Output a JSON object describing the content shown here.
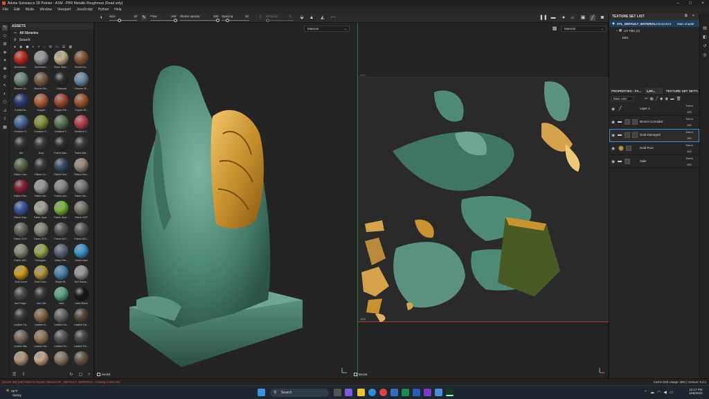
{
  "window": {
    "title": "Adobe Substance 3D Painter - ASM - PBR Metallic Roughness (Read only)"
  },
  "menu": [
    "File",
    "Edit",
    "Mode",
    "Window",
    "Viewport",
    "JavaScript",
    "Python",
    "Help"
  ],
  "toolbar": {
    "size_label": "Size",
    "size_value": "10",
    "flow_label": "Flow",
    "flow_value": "100",
    "stroke_opacity_label": "Stroke opacity",
    "stroke_opacity_value": "100",
    "spacing_label": "Spacing",
    "spacing_value": "20",
    "distance_label": "Distance",
    "distance_value": "0"
  },
  "assets": {
    "title": "ASSETS",
    "library": "All libraries",
    "search_placeholder": "Search",
    "materials": [
      {
        "name": "Aluminium...",
        "color": "#c52a1f"
      },
      {
        "name": "Aluminium...",
        "color": "#9a9a9a"
      },
      {
        "name": "Bone Style...",
        "color": "#c9b28a"
      },
      {
        "name": "Bronze Ar...",
        "color": "#8a5a35"
      },
      {
        "name": "Bronze Co...",
        "color": "#6f8c7a"
      },
      {
        "name": "Bronze Da...",
        "color": "#7a6048"
      },
      {
        "name": "Charcoal",
        "color": "#2d2d2d"
      },
      {
        "name": "Chrome Bl...",
        "color": "#6c8ea8"
      },
      {
        "name": "Cobalt Da...",
        "color": "#2a3e7a"
      },
      {
        "name": "Copper",
        "color": "#b5643a"
      },
      {
        "name": "Copper Re...",
        "color": "#a84a3a"
      },
      {
        "name": "Copper W...",
        "color": "#a85a30"
      },
      {
        "name": "Creature S...",
        "color": "#4a6a9a"
      },
      {
        "name": "Creature S...",
        "color": "#8a9a3a"
      },
      {
        "name": "Creature T...",
        "color": "#5a7a5a"
      },
      {
        "name": "Creature T...",
        "color": "#c04050"
      },
      {
        "name": "Dirt",
        "color": "#333333"
      },
      {
        "name": "Dust",
        "color": "#3a3a3a"
      },
      {
        "name": "Fabric Bas...",
        "color": "#2e2e2e"
      },
      {
        "name": "Fabric Bat...",
        "color": "#3a3a3a"
      },
      {
        "name": "Fabric Can...",
        "color": "#5a6a4a"
      },
      {
        "name": "Fabric Co...",
        "color": "#3a3a3a"
      },
      {
        "name": "Fabric Den...",
        "color": "#3c4f6a"
      },
      {
        "name": "Fabric Den...",
        "color": "#9a8a7a"
      },
      {
        "name": "Fabric Fiee...",
        "color": "#8a2030"
      },
      {
        "name": "Fabric Kni...",
        "color": "#9a9a9a"
      },
      {
        "name": "Fabric Lea...",
        "color": "#8a8a8a"
      },
      {
        "name": "Fabric Ste...",
        "color": "#7a7a7a"
      },
      {
        "name": "Fabric Sup...",
        "color": "#3a5aa8"
      },
      {
        "name": "Fabric Synt...",
        "color": "#a8a89a"
      },
      {
        "name": "Fabric Synt...",
        "color": "#7aba3a"
      },
      {
        "name": "Fabric SCP",
        "color": "#7a7a6a"
      },
      {
        "name": "Fabric SCP...",
        "color": "#6a6a5a"
      },
      {
        "name": "Fabric SCP...",
        "color": "#8a8a7a"
      },
      {
        "name": "Fabric WO...",
        "color": "#5a5a5a"
      },
      {
        "name": "Fabric WO...",
        "color": "#5a5a5a"
      },
      {
        "name": "Fabric WO...",
        "color": "#8a8a7a"
      },
      {
        "name": "Fiberglas...",
        "color": "#9aaa4a"
      },
      {
        "name": "Glass Ffer...",
        "color": "#5a6a7a"
      },
      {
        "name": "Glass Visor",
        "color": "#3a9ad8"
      },
      {
        "name": "Gold Armor",
        "color": "#d4a21a"
      },
      {
        "name": "Gold Dam...",
        "color": "#b89a3a"
      },
      {
        "name": "Height Bl...",
        "color": "#4a8ab8"
      },
      {
        "name": "Hull Dama...",
        "color": "#9a9a9a"
      },
      {
        "name": "Iron Forge...",
        "color": "#4a4a4a"
      },
      {
        "name": "Iron Old",
        "color": "#3a3a3a"
      },
      {
        "name": "Jade",
        "color": "#5aa88a"
      },
      {
        "name": "Latex Black",
        "color": "#1a1a1a"
      },
      {
        "name": "Leather Ca...",
        "color": "#3a3a3a"
      },
      {
        "name": "Leather Cr...",
        "color": "#8a6a4a"
      },
      {
        "name": "Leather Da...",
        "color": "#6a6a6a"
      },
      {
        "name": "Leather Da...",
        "color": "#5a4a3a"
      },
      {
        "name": "Leather Ma...",
        "color": "#7a6a5a"
      },
      {
        "name": "Leather Na...",
        "color": "#9a7a5a"
      },
      {
        "name": "Leather Ro...",
        "color": "#5a5a5a"
      },
      {
        "name": "Leather Ro...",
        "color": "#4a4a4a"
      },
      {
        "name": "Leather Na...",
        "color": "#b89a7a"
      },
      {
        "name": "Leather Ro...",
        "color": "#c8a888"
      },
      {
        "name": "Leather Se...",
        "color": "#8a7a6a"
      },
      {
        "name": "Leather Se...",
        "color": "#6a5a4a"
      }
    ]
  },
  "viewport": {
    "left_channel": "Material",
    "right_channel": "Material",
    "mask_label": "MASK",
    "udim_top": "1011",
    "udim_bottom": "1001"
  },
  "texture_set_list": {
    "title": "TEXTURE SET LIST",
    "set_name": "STL_DEFAULT_MATERIAL",
    "resolution": "1024x1024",
    "shader": "Main shader",
    "uv_tiles": "UV Tiles (1)",
    "tile": "1001"
  },
  "layers_panel": {
    "tabs": [
      "PROPERTIES - FA...",
      "LAY...",
      "TEXTURE SET SETTI..."
    ],
    "blend_select": "Base color",
    "layers": [
      {
        "name": "Layer 1",
        "blend": "Norm",
        "opacity": "100"
      },
      {
        "name": "Bronze Corroded",
        "blend": "Norm",
        "opacity": "100"
      },
      {
        "name": "Gold Damaged",
        "blend": "Norm",
        "opacity": "100"
      },
      {
        "name": "Gold Pure",
        "blend": "Norm",
        "opacity": "100"
      },
      {
        "name": "Jade",
        "blend": "Norm",
        "opacity": "100"
      }
    ]
  },
  "status": {
    "error": "[Scene 3D] [UE] Failed to locate material STL_DEFAULT_MATERIAL, creating a new one",
    "cache": "Cache Disk Usage:  25% | Version: 8.3.1"
  },
  "taskbar": {
    "temp": "55°F",
    "weather": "Sunny",
    "search": "Search",
    "time": "12:17 PM",
    "date": "11/6/2023"
  }
}
